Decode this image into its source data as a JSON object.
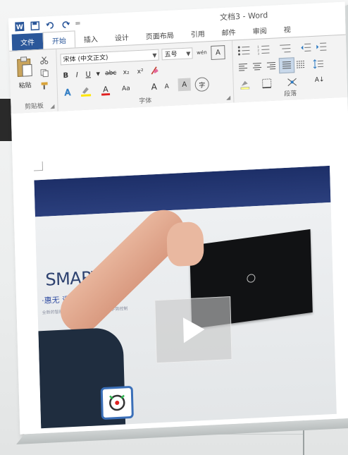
{
  "window": {
    "title": "文档3 - Word"
  },
  "quick_access": {
    "icons": [
      "word-icon",
      "save-icon",
      "undo-icon",
      "redo-icon"
    ],
    "customize_symbol": "="
  },
  "tabs": [
    {
      "label": "文件",
      "kind": "file"
    },
    {
      "label": "开始",
      "kind": "active"
    },
    {
      "label": "插入",
      "kind": "normal"
    },
    {
      "label": "设计",
      "kind": "normal"
    },
    {
      "label": "页面布局",
      "kind": "normal"
    },
    {
      "label": "引用",
      "kind": "normal"
    },
    {
      "label": "邮件",
      "kind": "normal"
    },
    {
      "label": "审阅",
      "kind": "normal"
    },
    {
      "label": "视",
      "kind": "normal"
    }
  ],
  "ribbon": {
    "clipboard": {
      "paste_label": "粘贴",
      "group_label": "剪贴板"
    },
    "font": {
      "font_name": "宋体 (中文正文)",
      "font_size": "五号",
      "bold": "B",
      "italic": "I",
      "underline": "U",
      "strike": "abc",
      "subscript": "x₂",
      "superscript": "x²",
      "change_case": "Aa",
      "grow": "A",
      "shrink": "A",
      "char_shading": "A",
      "group_label": "字体",
      "wen": "wén",
      "char_box": "A",
      "enclose": "字"
    },
    "paragraph": {
      "group_label": "段落",
      "sort": "A↓"
    }
  },
  "video": {
    "brand_text": "SMART TV",
    "sub_text": "·惠无  遥手随心",
    "tiny_text": "全新的智能电视操作系统与体验 通过手势控制",
    "play_label": "播放"
  },
  "colors": {
    "file_tab_bg": "#2b579a",
    "ribbon_bg": "#f3f3f3",
    "banner": "#1d2f68"
  }
}
